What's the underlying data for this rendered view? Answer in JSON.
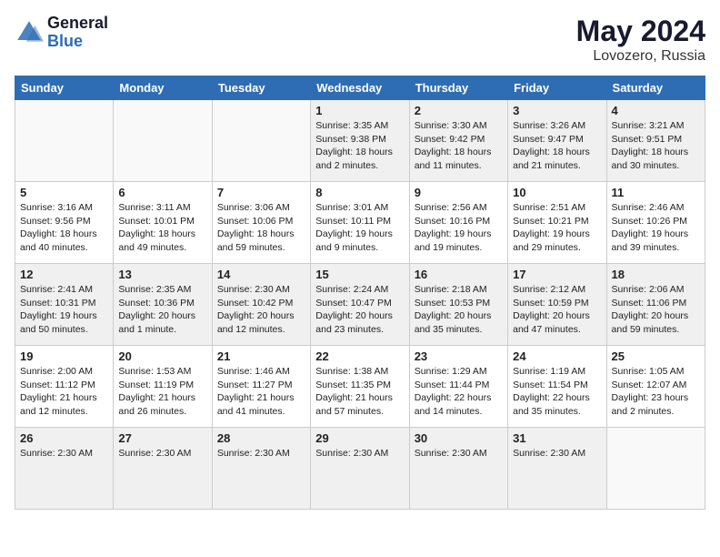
{
  "header": {
    "logo_general": "General",
    "logo_blue": "Blue",
    "month_year": "May 2024",
    "location": "Lovozero, Russia"
  },
  "days_of_week": [
    "Sunday",
    "Monday",
    "Tuesday",
    "Wednesday",
    "Thursday",
    "Friday",
    "Saturday"
  ],
  "weeks": [
    [
      {
        "day": "",
        "info": "",
        "empty": true
      },
      {
        "day": "",
        "info": "",
        "empty": true
      },
      {
        "day": "",
        "info": "",
        "empty": true
      },
      {
        "day": "1",
        "info": "Sunrise: 3:35 AM\nSunset: 9:38 PM\nDaylight: 18 hours\nand 2 minutes."
      },
      {
        "day": "2",
        "info": "Sunrise: 3:30 AM\nSunset: 9:42 PM\nDaylight: 18 hours\nand 11 minutes."
      },
      {
        "day": "3",
        "info": "Sunrise: 3:26 AM\nSunset: 9:47 PM\nDaylight: 18 hours\nand 21 minutes."
      },
      {
        "day": "4",
        "info": "Sunrise: 3:21 AM\nSunset: 9:51 PM\nDaylight: 18 hours\nand 30 minutes."
      }
    ],
    [
      {
        "day": "5",
        "info": "Sunrise: 3:16 AM\nSunset: 9:56 PM\nDaylight: 18 hours\nand 40 minutes."
      },
      {
        "day": "6",
        "info": "Sunrise: 3:11 AM\nSunset: 10:01 PM\nDaylight: 18 hours\nand 49 minutes."
      },
      {
        "day": "7",
        "info": "Sunrise: 3:06 AM\nSunset: 10:06 PM\nDaylight: 18 hours\nand 59 minutes."
      },
      {
        "day": "8",
        "info": "Sunrise: 3:01 AM\nSunset: 10:11 PM\nDaylight: 19 hours\nand 9 minutes."
      },
      {
        "day": "9",
        "info": "Sunrise: 2:56 AM\nSunset: 10:16 PM\nDaylight: 19 hours\nand 19 minutes."
      },
      {
        "day": "10",
        "info": "Sunrise: 2:51 AM\nSunset: 10:21 PM\nDaylight: 19 hours\nand 29 minutes."
      },
      {
        "day": "11",
        "info": "Sunrise: 2:46 AM\nSunset: 10:26 PM\nDaylight: 19 hours\nand 39 minutes."
      }
    ],
    [
      {
        "day": "12",
        "info": "Sunrise: 2:41 AM\nSunset: 10:31 PM\nDaylight: 19 hours\nand 50 minutes."
      },
      {
        "day": "13",
        "info": "Sunrise: 2:35 AM\nSunset: 10:36 PM\nDaylight: 20 hours\nand 1 minute."
      },
      {
        "day": "14",
        "info": "Sunrise: 2:30 AM\nSunset: 10:42 PM\nDaylight: 20 hours\nand 12 minutes."
      },
      {
        "day": "15",
        "info": "Sunrise: 2:24 AM\nSunset: 10:47 PM\nDaylight: 20 hours\nand 23 minutes."
      },
      {
        "day": "16",
        "info": "Sunrise: 2:18 AM\nSunset: 10:53 PM\nDaylight: 20 hours\nand 35 minutes."
      },
      {
        "day": "17",
        "info": "Sunrise: 2:12 AM\nSunset: 10:59 PM\nDaylight: 20 hours\nand 47 minutes."
      },
      {
        "day": "18",
        "info": "Sunrise: 2:06 AM\nSunset: 11:06 PM\nDaylight: 20 hours\nand 59 minutes."
      }
    ],
    [
      {
        "day": "19",
        "info": "Sunrise: 2:00 AM\nSunset: 11:12 PM\nDaylight: 21 hours\nand 12 minutes."
      },
      {
        "day": "20",
        "info": "Sunrise: 1:53 AM\nSunset: 11:19 PM\nDaylight: 21 hours\nand 26 minutes."
      },
      {
        "day": "21",
        "info": "Sunrise: 1:46 AM\nSunset: 11:27 PM\nDaylight: 21 hours\nand 41 minutes."
      },
      {
        "day": "22",
        "info": "Sunrise: 1:38 AM\nSunset: 11:35 PM\nDaylight: 21 hours\nand 57 minutes."
      },
      {
        "day": "23",
        "info": "Sunrise: 1:29 AM\nSunset: 11:44 PM\nDaylight: 22 hours\nand 14 minutes."
      },
      {
        "day": "24",
        "info": "Sunrise: 1:19 AM\nSunset: 11:54 PM\nDaylight: 22 hours\nand 35 minutes."
      },
      {
        "day": "25",
        "info": "Sunrise: 1:05 AM\nSunset: 12:07 AM\nDaylight: 23 hours\nand 2 minutes."
      }
    ],
    [
      {
        "day": "26",
        "info": "Sunrise: 2:30 AM"
      },
      {
        "day": "27",
        "info": "Sunrise: 2:30 AM"
      },
      {
        "day": "28",
        "info": "Sunrise: 2:30 AM"
      },
      {
        "day": "29",
        "info": "Sunrise: 2:30 AM"
      },
      {
        "day": "30",
        "info": "Sunrise: 2:30 AM"
      },
      {
        "day": "31",
        "info": "Sunrise: 2:30 AM"
      },
      {
        "day": "",
        "info": "",
        "empty": true
      }
    ]
  ]
}
